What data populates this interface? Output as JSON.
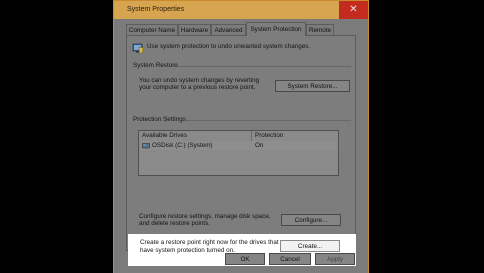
{
  "window": {
    "title": "System Properties",
    "close_glyph": "✕"
  },
  "tabs": [
    {
      "label": "Computer Name",
      "active": false
    },
    {
      "label": "Hardware",
      "active": false
    },
    {
      "label": "Advanced",
      "active": false
    },
    {
      "label": "System Protection",
      "active": true
    },
    {
      "label": "Remote",
      "active": false
    }
  ],
  "intro": {
    "text": "Use system protection to undo unwanted system changes.",
    "icon": "shield-computer-icon"
  },
  "system_restore": {
    "heading": "System Restore",
    "description_line1": "You can undo system changes by reverting",
    "description_line2": "your computer to a previous restore point.",
    "button_label": "System Restore..."
  },
  "protection_settings": {
    "heading": "Protection Settings",
    "columns": [
      "Available Drives",
      "Protection"
    ],
    "rows": [
      {
        "drive": "OSDisk (C:) (System)",
        "protection": "On",
        "icon": "drive-icon"
      }
    ],
    "configure_text_line1": "Configure restore settings, manage disk space,",
    "configure_text_line2": "and delete restore points.",
    "configure_button_label": "Configure...",
    "create_text_line1": "Create a restore point right now for the drives that",
    "create_text_line2": "have system protection turned on.",
    "create_button_label": "Create..."
  },
  "footer": {
    "ok_label": "OK",
    "cancel_label": "Cancel",
    "apply_label": "Apply"
  }
}
